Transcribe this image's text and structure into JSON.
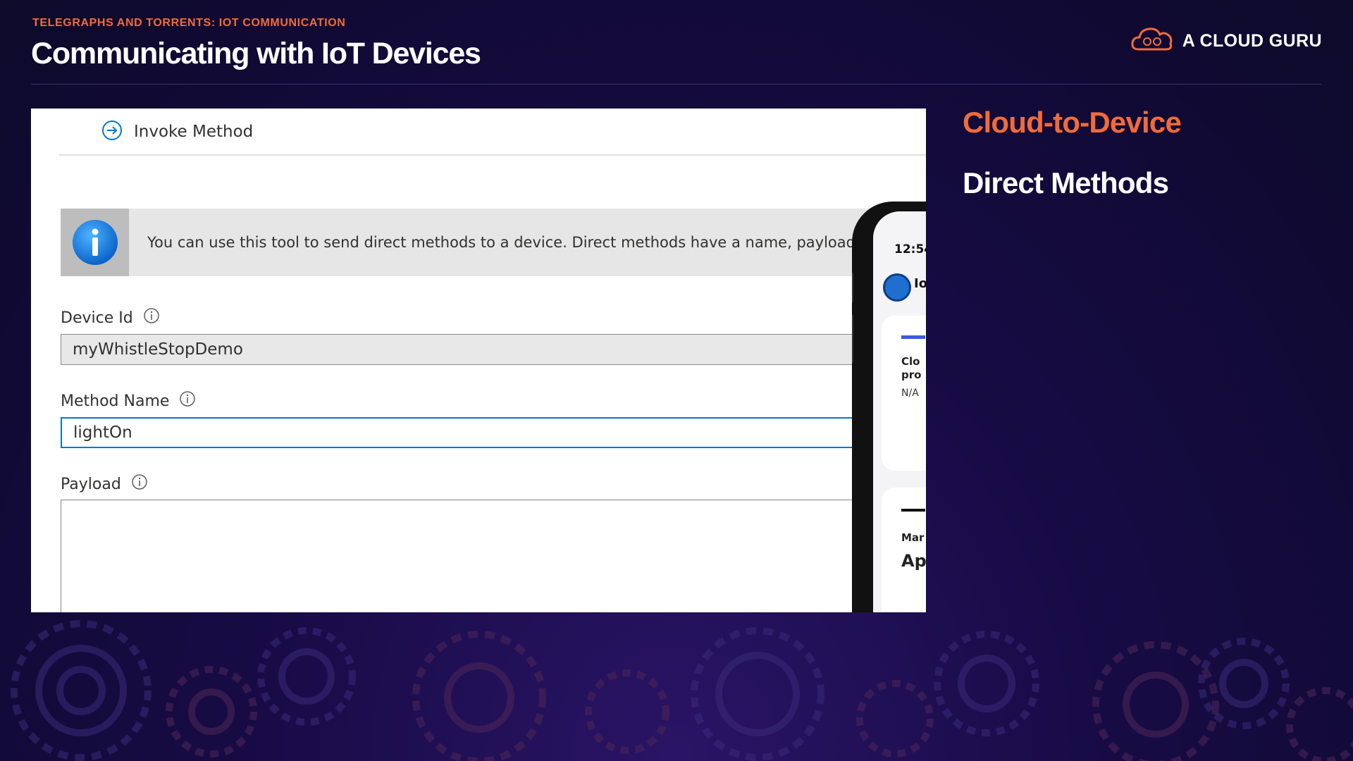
{
  "slide": {
    "kicker": "TELEGRAPHS AND TORRENTS: IOT COMMUNICATION",
    "title": "Communicating with IoT Devices",
    "brand": "A CLOUD GURU",
    "heading_primary": "Cloud-to-Device",
    "heading_secondary": "Direct Methods"
  },
  "panel": {
    "header_label": "Invoke Method",
    "info_text": "You can use this tool to send direct methods to a device. Direct methods have a name, payload, ar",
    "fields": {
      "device_id_label": "Device Id",
      "device_id_value": "myWhistleStopDemo",
      "method_name_label": "Method Name",
      "method_name_value": "lightOn",
      "payload_label": "Payload"
    }
  },
  "phone": {
    "time": "12:54",
    "app_text": "Io",
    "card1_title_line1": "Clo",
    "card1_title_line2": "pro",
    "card1_value": "N/A",
    "card2_label": "Mar",
    "card2_value": "Ap"
  },
  "colors": {
    "accent_orange": "#f26b3a",
    "azure_blue": "#0078d4",
    "background_dark": "#170b45"
  },
  "icons": [
    "cloud-logo-icon",
    "arrow-circle-right-icon",
    "info-icon",
    "info-circle-icon",
    "gear-decoration-icon"
  ]
}
